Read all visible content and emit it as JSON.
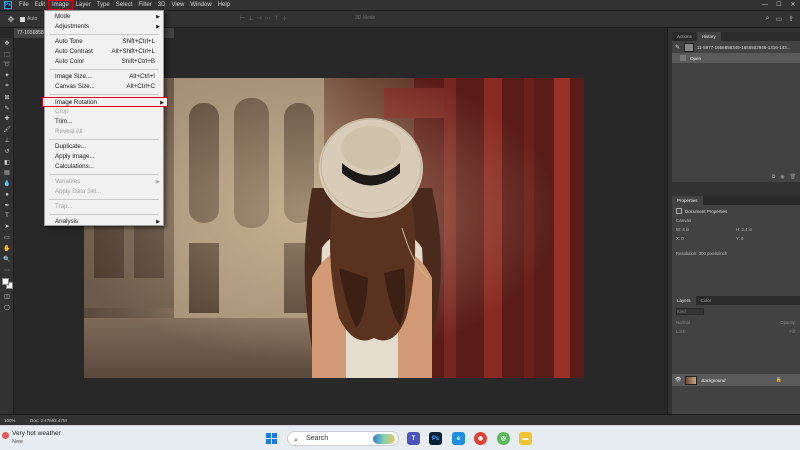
{
  "menubar": {
    "items": [
      "File",
      "Edit",
      "Image",
      "Layer",
      "Type",
      "Select",
      "Filter",
      "3D",
      "View",
      "Window",
      "Help"
    ],
    "active": "Image"
  },
  "options_bar": {
    "auto_select_label": "Auto",
    "mode_3d": "3D Mode"
  },
  "document_tab": {
    "title": "77-1656858346..."
  },
  "image_menu": {
    "items": [
      {
        "label": "Mode",
        "shortcut": "",
        "submenu": true,
        "disabled": false,
        "highlight": false
      },
      {
        "label": "Adjustments",
        "shortcut": "",
        "submenu": true,
        "disabled": false,
        "highlight": false
      },
      {
        "label": "Auto Tone",
        "shortcut": "Shift+Ctrl+L",
        "submenu": false,
        "disabled": false,
        "highlight": false
      },
      {
        "label": "Auto Contrast",
        "shortcut": "Alt+Shift+Ctrl+L",
        "submenu": false,
        "disabled": false,
        "highlight": false
      },
      {
        "label": "Auto Color",
        "shortcut": "Shift+Ctrl+B",
        "submenu": false,
        "disabled": false,
        "highlight": false
      },
      {
        "label": "Image Size...",
        "shortcut": "Alt+Ctrl+I",
        "submenu": false,
        "disabled": false,
        "highlight": false
      },
      {
        "label": "Canvas Size...",
        "shortcut": "Alt+Ctrl+C",
        "submenu": false,
        "disabled": false,
        "highlight": false
      },
      {
        "label": "Image Rotation",
        "shortcut": "",
        "submenu": true,
        "disabled": false,
        "highlight": true
      },
      {
        "label": "Crop",
        "shortcut": "",
        "submenu": false,
        "disabled": true,
        "highlight": false
      },
      {
        "label": "Trim...",
        "shortcut": "",
        "submenu": false,
        "disabled": false,
        "highlight": false
      },
      {
        "label": "Reveal All",
        "shortcut": "",
        "submenu": false,
        "disabled": true,
        "highlight": false
      },
      {
        "label": "Duplicate...",
        "shortcut": "",
        "submenu": false,
        "disabled": false,
        "highlight": false
      },
      {
        "label": "Apply Image...",
        "shortcut": "",
        "submenu": false,
        "disabled": false,
        "highlight": false
      },
      {
        "label": "Calculations...",
        "shortcut": "",
        "submenu": false,
        "disabled": false,
        "highlight": false
      },
      {
        "label": "Variables",
        "shortcut": "",
        "submenu": true,
        "disabled": true,
        "highlight": false
      },
      {
        "label": "Apply Data Set...",
        "shortcut": "",
        "submenu": false,
        "disabled": true,
        "highlight": false
      },
      {
        "label": "Trap...",
        "shortcut": "",
        "submenu": false,
        "disabled": true,
        "highlight": false
      },
      {
        "label": "Analysis",
        "shortcut": "",
        "submenu": true,
        "disabled": false,
        "highlight": false
      }
    ]
  },
  "history_panel": {
    "tabs": [
      "Actions",
      "History"
    ],
    "active_tab": "History",
    "snapshot_label": "11-5977-1656858349-1656502946-1316-143...",
    "states": [
      "Open"
    ]
  },
  "properties_panel": {
    "tabs": [
      "Properties"
    ],
    "title": "Document Properties",
    "section": "Canvas",
    "width_label": "W:",
    "width_value": "4 in",
    "height_label": "H:",
    "height_value": "2.4 in",
    "x_label": "X:",
    "x_value": "0",
    "y_label": "Y:",
    "y_value": "0",
    "resolution": "Resolution: 300 pixels/inch"
  },
  "layers_panel": {
    "tabs": [
      "Layers",
      "Color"
    ],
    "active_tab": "Layers",
    "kind_label": "Kind",
    "blend_mode": "Normal",
    "opacity_label": "Opacity:",
    "lock_label": "Lock:",
    "fill_label": "Fill:",
    "layer_name": "Background"
  },
  "status_bar": {
    "zoom": "100%",
    "doc_info": "Doc: 2.47M/2.47M"
  },
  "taskbar": {
    "weather_title": "Very hot weather",
    "weather_sub": "Now",
    "search_placeholder": "Search"
  },
  "colors": {
    "highlight_border": "#e30000",
    "ps_blue": "#31a8ff"
  }
}
